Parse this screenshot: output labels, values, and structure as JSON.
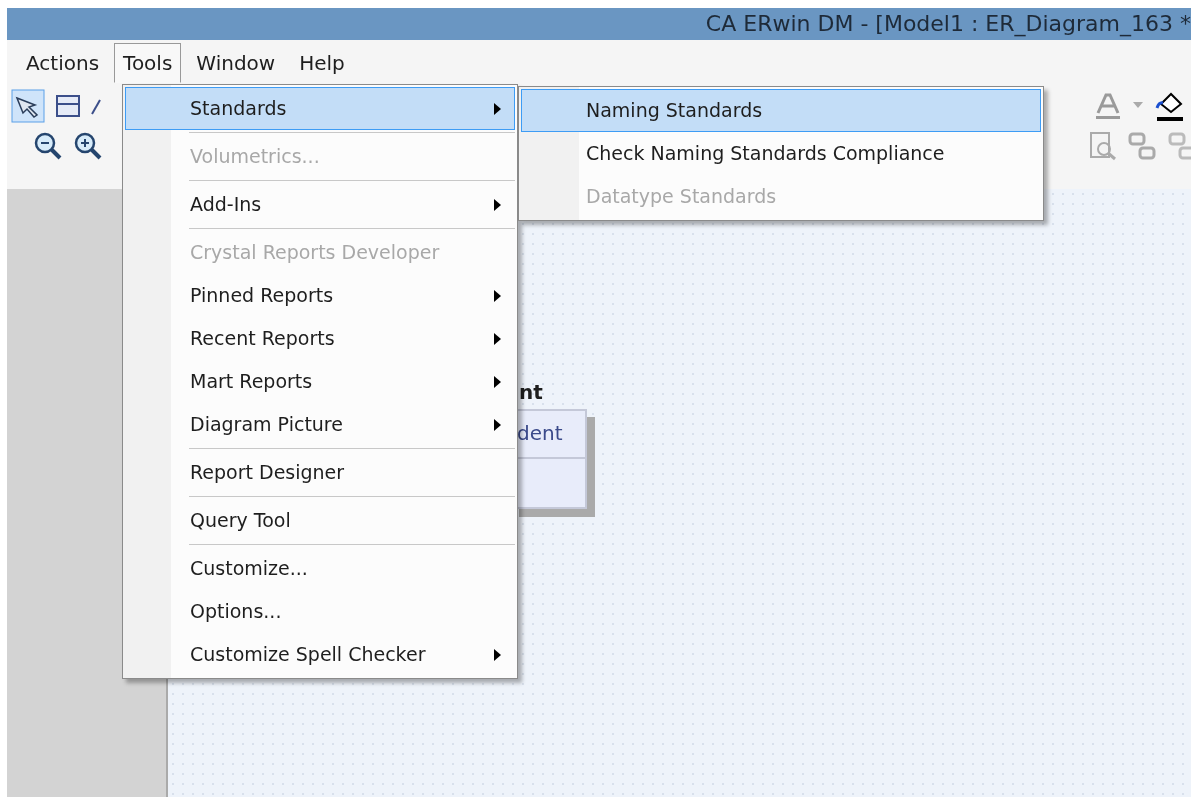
{
  "window": {
    "title": "CA ERwin DM - [Model1 : ER_Diagram_163 *"
  },
  "menu_bar": [
    {
      "label": "Actions",
      "selected": false
    },
    {
      "label": "Tools",
      "selected": true
    },
    {
      "label": "Window",
      "selected": false
    },
    {
      "label": "Help",
      "selected": false
    }
  ],
  "tools_menu": {
    "groups": [
      [
        {
          "label": "Standards",
          "selected": true,
          "disabled": false,
          "submenu": true
        }
      ],
      [
        {
          "label": "Volumetrics...",
          "selected": false,
          "disabled": true,
          "submenu": false
        }
      ],
      [
        {
          "label": "Add-Ins",
          "selected": false,
          "disabled": false,
          "submenu": true
        }
      ],
      [
        {
          "label": "Crystal Reports Developer",
          "selected": false,
          "disabled": true,
          "submenu": false
        },
        {
          "label": "Pinned Reports",
          "selected": false,
          "disabled": false,
          "submenu": true
        },
        {
          "label": "Recent Reports",
          "selected": false,
          "disabled": false,
          "submenu": true
        },
        {
          "label": "Mart Reports",
          "selected": false,
          "disabled": false,
          "submenu": true
        },
        {
          "label": "Diagram Picture",
          "selected": false,
          "disabled": false,
          "submenu": true
        }
      ],
      [
        {
          "label": "Report Designer",
          "selected": false,
          "disabled": false,
          "submenu": false
        }
      ],
      [
        {
          "label": "Query Tool",
          "selected": false,
          "disabled": false,
          "submenu": false
        }
      ],
      [
        {
          "label": "Customize...",
          "selected": false,
          "disabled": false,
          "submenu": false
        },
        {
          "label": "Options...",
          "selected": false,
          "disabled": false,
          "submenu": false
        },
        {
          "label": "Customize Spell Checker",
          "selected": false,
          "disabled": false,
          "submenu": true
        }
      ]
    ]
  },
  "standards_submenu": {
    "items": [
      {
        "label": "Naming Standards",
        "selected": true,
        "disabled": false
      },
      {
        "label": "Check Naming Standards Compliance",
        "selected": false,
        "disabled": false
      },
      {
        "label": "Datatype Standards",
        "selected": false,
        "disabled": true
      }
    ]
  },
  "entity": {
    "name": "nt",
    "attribute": "dent"
  }
}
